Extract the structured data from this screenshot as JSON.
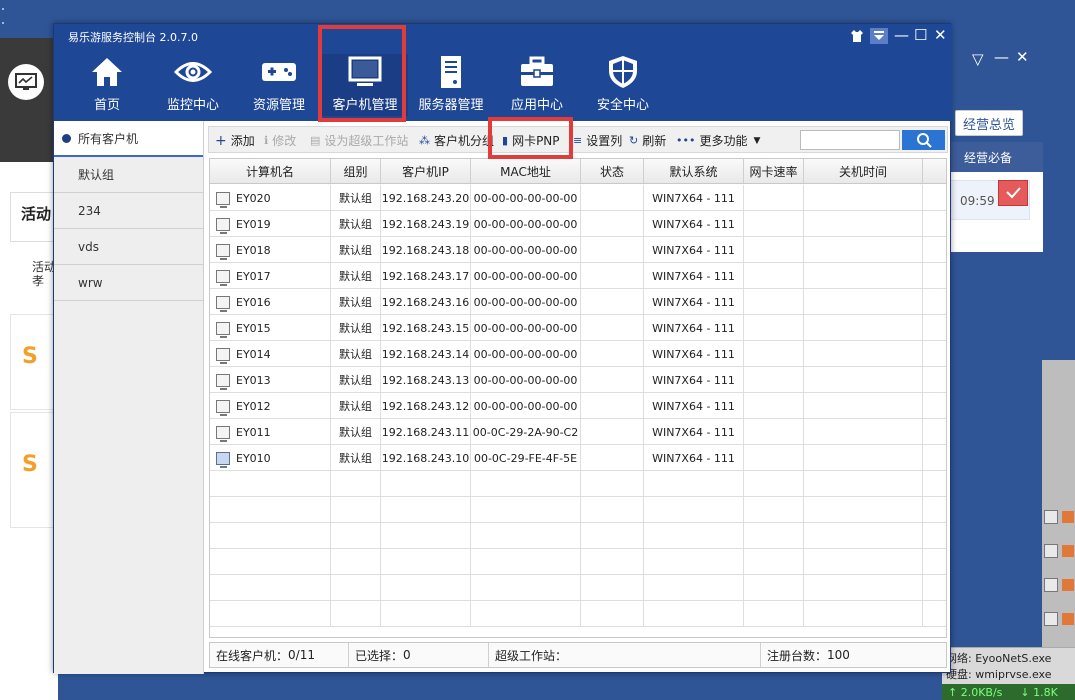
{
  "app": {
    "title": "易乐游服务控制台 2.0.7.0"
  },
  "nav": [
    {
      "label": "首页",
      "icon": "home-icon"
    },
    {
      "label": "监控中心",
      "icon": "eye-icon"
    },
    {
      "label": "资源管理",
      "icon": "gamepad-icon"
    },
    {
      "label": "客户机管理",
      "icon": "monitor-icon",
      "active": true
    },
    {
      "label": "服务器管理",
      "icon": "server-icon"
    },
    {
      "label": "应用中心",
      "icon": "toolbox-icon"
    },
    {
      "label": "安全中心",
      "icon": "shield-icon"
    }
  ],
  "sidebar": {
    "items": [
      "所有客户机",
      "默认组",
      "234",
      "vds",
      "wrw"
    ],
    "active_index": 0
  },
  "toolbar": {
    "add": "添加",
    "edit": "修改",
    "set_super": "设为超级工作站",
    "group": "客户机分组",
    "nic_pnp": "网卡PNP",
    "columns": "设置列",
    "refresh": "刷新",
    "more": "更多功能"
  },
  "table": {
    "headers": [
      "计算机名",
      "组别",
      "客户机IP",
      "MAC地址",
      "状态",
      "默认系统",
      "网卡速率",
      "关机时间"
    ],
    "rows": [
      {
        "name": "EY020",
        "group": "默认组",
        "ip": "192.168.243.20",
        "mac": "00-00-00-00-00-00",
        "status": "",
        "os": "WIN7X64 - 111",
        "speed": "",
        "shutdown": ""
      },
      {
        "name": "EY019",
        "group": "默认组",
        "ip": "192.168.243.19",
        "mac": "00-00-00-00-00-00",
        "status": "",
        "os": "WIN7X64 - 111",
        "speed": "",
        "shutdown": ""
      },
      {
        "name": "EY018",
        "group": "默认组",
        "ip": "192.168.243.18",
        "mac": "00-00-00-00-00-00",
        "status": "",
        "os": "WIN7X64 - 111",
        "speed": "",
        "shutdown": ""
      },
      {
        "name": "EY017",
        "group": "默认组",
        "ip": "192.168.243.17",
        "mac": "00-00-00-00-00-00",
        "status": "",
        "os": "WIN7X64 - 111",
        "speed": "",
        "shutdown": ""
      },
      {
        "name": "EY016",
        "group": "默认组",
        "ip": "192.168.243.16",
        "mac": "00-00-00-00-00-00",
        "status": "",
        "os": "WIN7X64 - 111",
        "speed": "",
        "shutdown": ""
      },
      {
        "name": "EY015",
        "group": "默认组",
        "ip": "192.168.243.15",
        "mac": "00-00-00-00-00-00",
        "status": "",
        "os": "WIN7X64 - 111",
        "speed": "",
        "shutdown": ""
      },
      {
        "name": "EY014",
        "group": "默认组",
        "ip": "192.168.243.14",
        "mac": "00-00-00-00-00-00",
        "status": "",
        "os": "WIN7X64 - 111",
        "speed": "",
        "shutdown": ""
      },
      {
        "name": "EY013",
        "group": "默认组",
        "ip": "192.168.243.13",
        "mac": "00-00-00-00-00-00",
        "status": "",
        "os": "WIN7X64 - 111",
        "speed": "",
        "shutdown": ""
      },
      {
        "name": "EY012",
        "group": "默认组",
        "ip": "192.168.243.12",
        "mac": "00-00-00-00-00-00",
        "status": "",
        "os": "WIN7X64 - 111",
        "speed": "",
        "shutdown": ""
      },
      {
        "name": "EY011",
        "group": "默认组",
        "ip": "192.168.243.11",
        "mac": "00-0C-29-2A-90-C2",
        "status": "",
        "os": "WIN7X64 - 111",
        "speed": "",
        "shutdown": ""
      },
      {
        "name": "EY010",
        "group": "默认组",
        "ip": "192.168.243.10",
        "mac": "00-0C-29-FE-4F-5E",
        "status": "",
        "os": "WIN7X64 - 111",
        "speed": "",
        "shutdown": ""
      }
    ]
  },
  "status": {
    "online_label": "在线客户机：",
    "online_value": "0/11",
    "selected_label": "已选择：",
    "selected_value": "0",
    "super_label": "超级工作站：",
    "super_value": "",
    "registered_label": "注册台数：",
    "registered_value": "100"
  },
  "background_right": {
    "overview": "经营总览",
    "essentials": "经营必备",
    "time": "09:59"
  },
  "background_left": {
    "header": "活动",
    "sub": "活动\n孝"
  },
  "tray": {
    "line1": "网络: EyooNetS.exe",
    "line2": "硬盘: wmiprvse.exe",
    "up": "↑ 2.0KB/s",
    "down": "↓ 1.8K"
  },
  "colors": {
    "title_bar": "#1e4796",
    "highlight": "#e23b3b",
    "search_button": "#2a74d3"
  }
}
